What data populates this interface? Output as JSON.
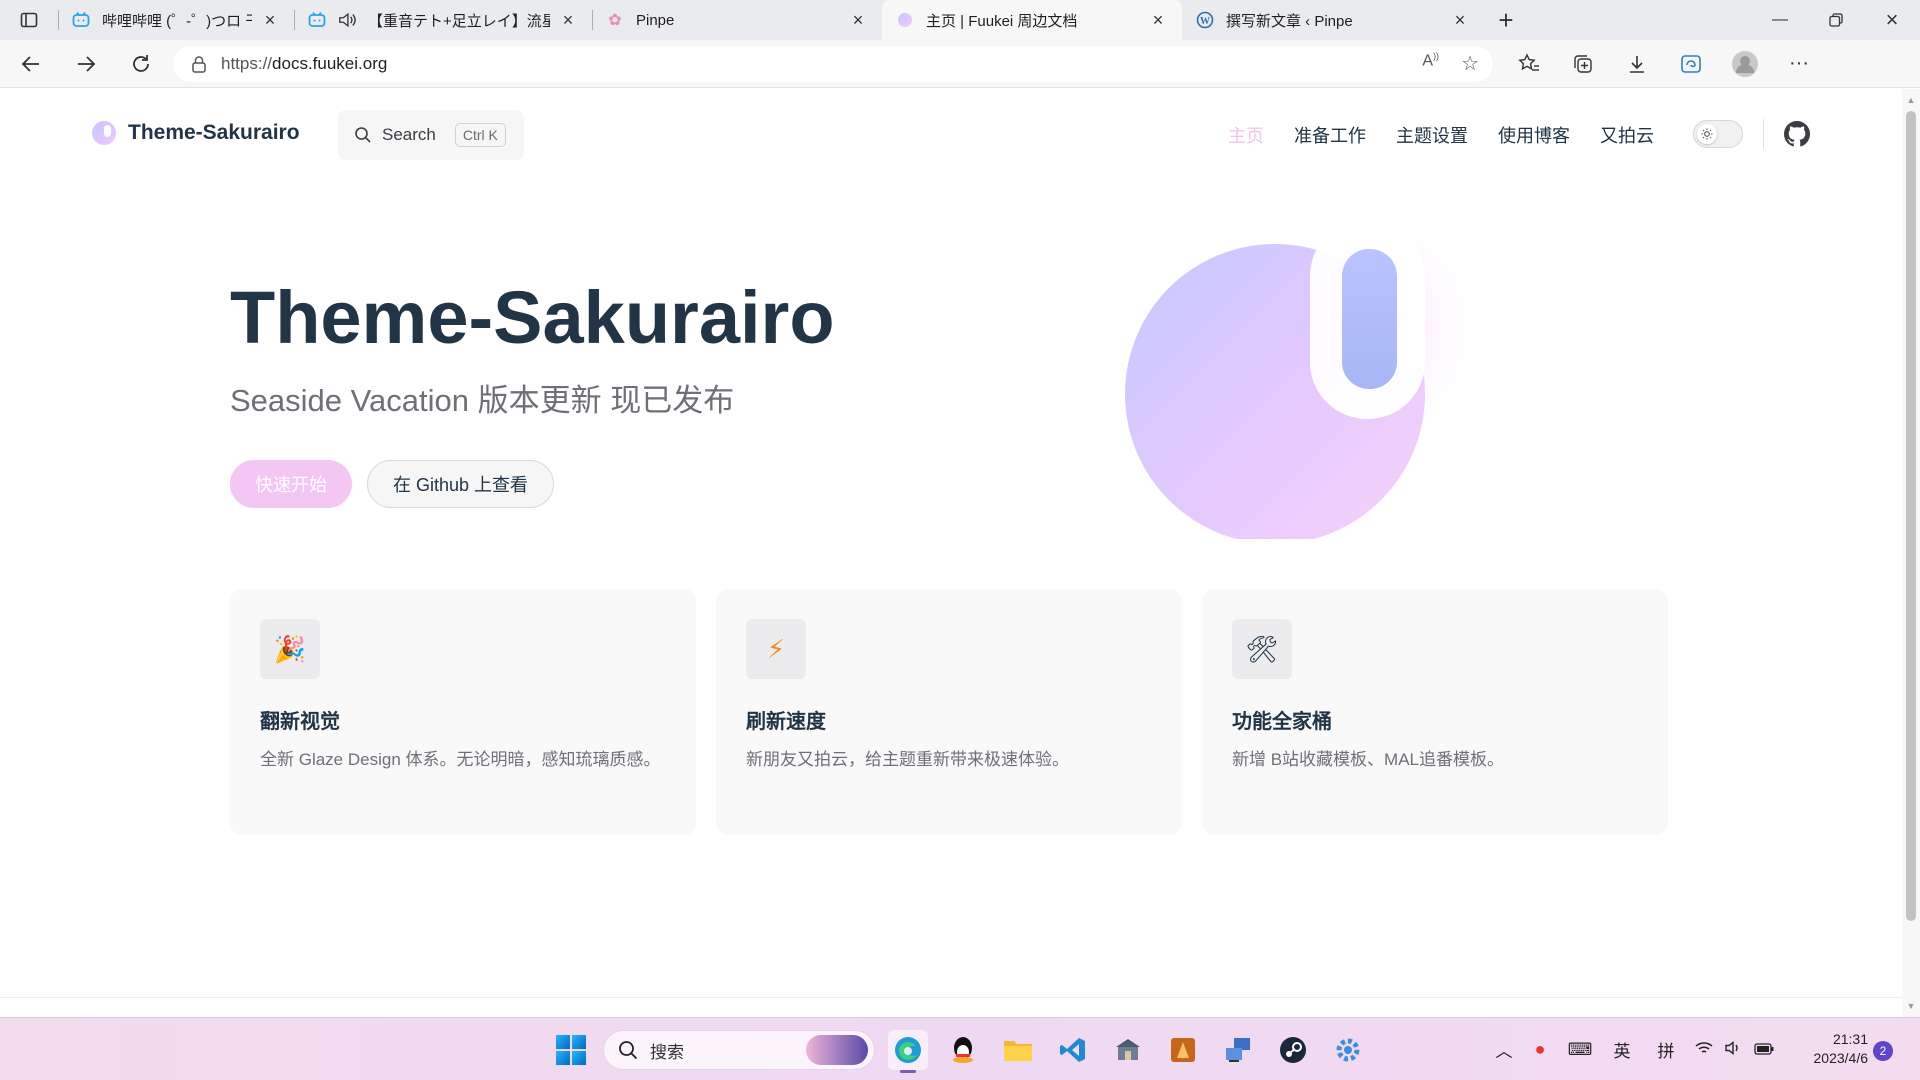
{
  "browser": {
    "tabs": [
      {
        "title": "哔哩哔哩 (゜-゜)つロ 干杯~-bilibili",
        "favicon": "bilibili-icon"
      },
      {
        "title": "【重音テト+足立レイ】流星",
        "favicon": "bilibili-icon",
        "audio": "speaker-icon"
      },
      {
        "title": "Pinpe",
        "favicon": "sakura-icon"
      },
      {
        "title": "主页 | Fuukei 周边文档",
        "favicon": "sakurairo-icon"
      },
      {
        "title": "撰写新文章 ‹ Pinpe",
        "favicon": "wordpress-icon"
      }
    ],
    "active_tab": 3,
    "new_tab_label": "+",
    "address": {
      "scheme": "https://",
      "host": "docs.fuukei.org"
    }
  },
  "site": {
    "logo_text": "Theme-Sakurairo",
    "search": {
      "label": "Search",
      "shortcut": "Ctrl K"
    },
    "nav": [
      "主页",
      "准备工作",
      "主题设置",
      "使用博客",
      "又拍云"
    ],
    "hero": {
      "title": "Theme-Sakurairo",
      "subtitle": "Seaside Vacation 版本更新 现已发布",
      "primary_button": "快速开始",
      "secondary_button": "在 Github 上查看"
    },
    "features": [
      {
        "icon": "🎉",
        "title": "翻新视觉",
        "desc": "全新 Glaze Design 体系。无论明暗，感知琉璃质感。"
      },
      {
        "icon": "⚡",
        "title": "刷新速度",
        "desc": "新朋友又拍云，给主题重新带来极速体验。"
      },
      {
        "icon": "🛠",
        "title": "功能全家桶",
        "desc": "新增 B站收藏模板、MAL追番模板。"
      }
    ],
    "colors": {
      "brand": "#f3c6f3",
      "text": "#213547",
      "muted": "#6f6f78"
    }
  },
  "taskbar": {
    "search_placeholder": "搜索",
    "tray": {
      "ime_lang": "英",
      "ime_mode": "拼"
    },
    "clock": {
      "time": "21:31",
      "date": "2023/4/6"
    },
    "notifications": "2"
  }
}
